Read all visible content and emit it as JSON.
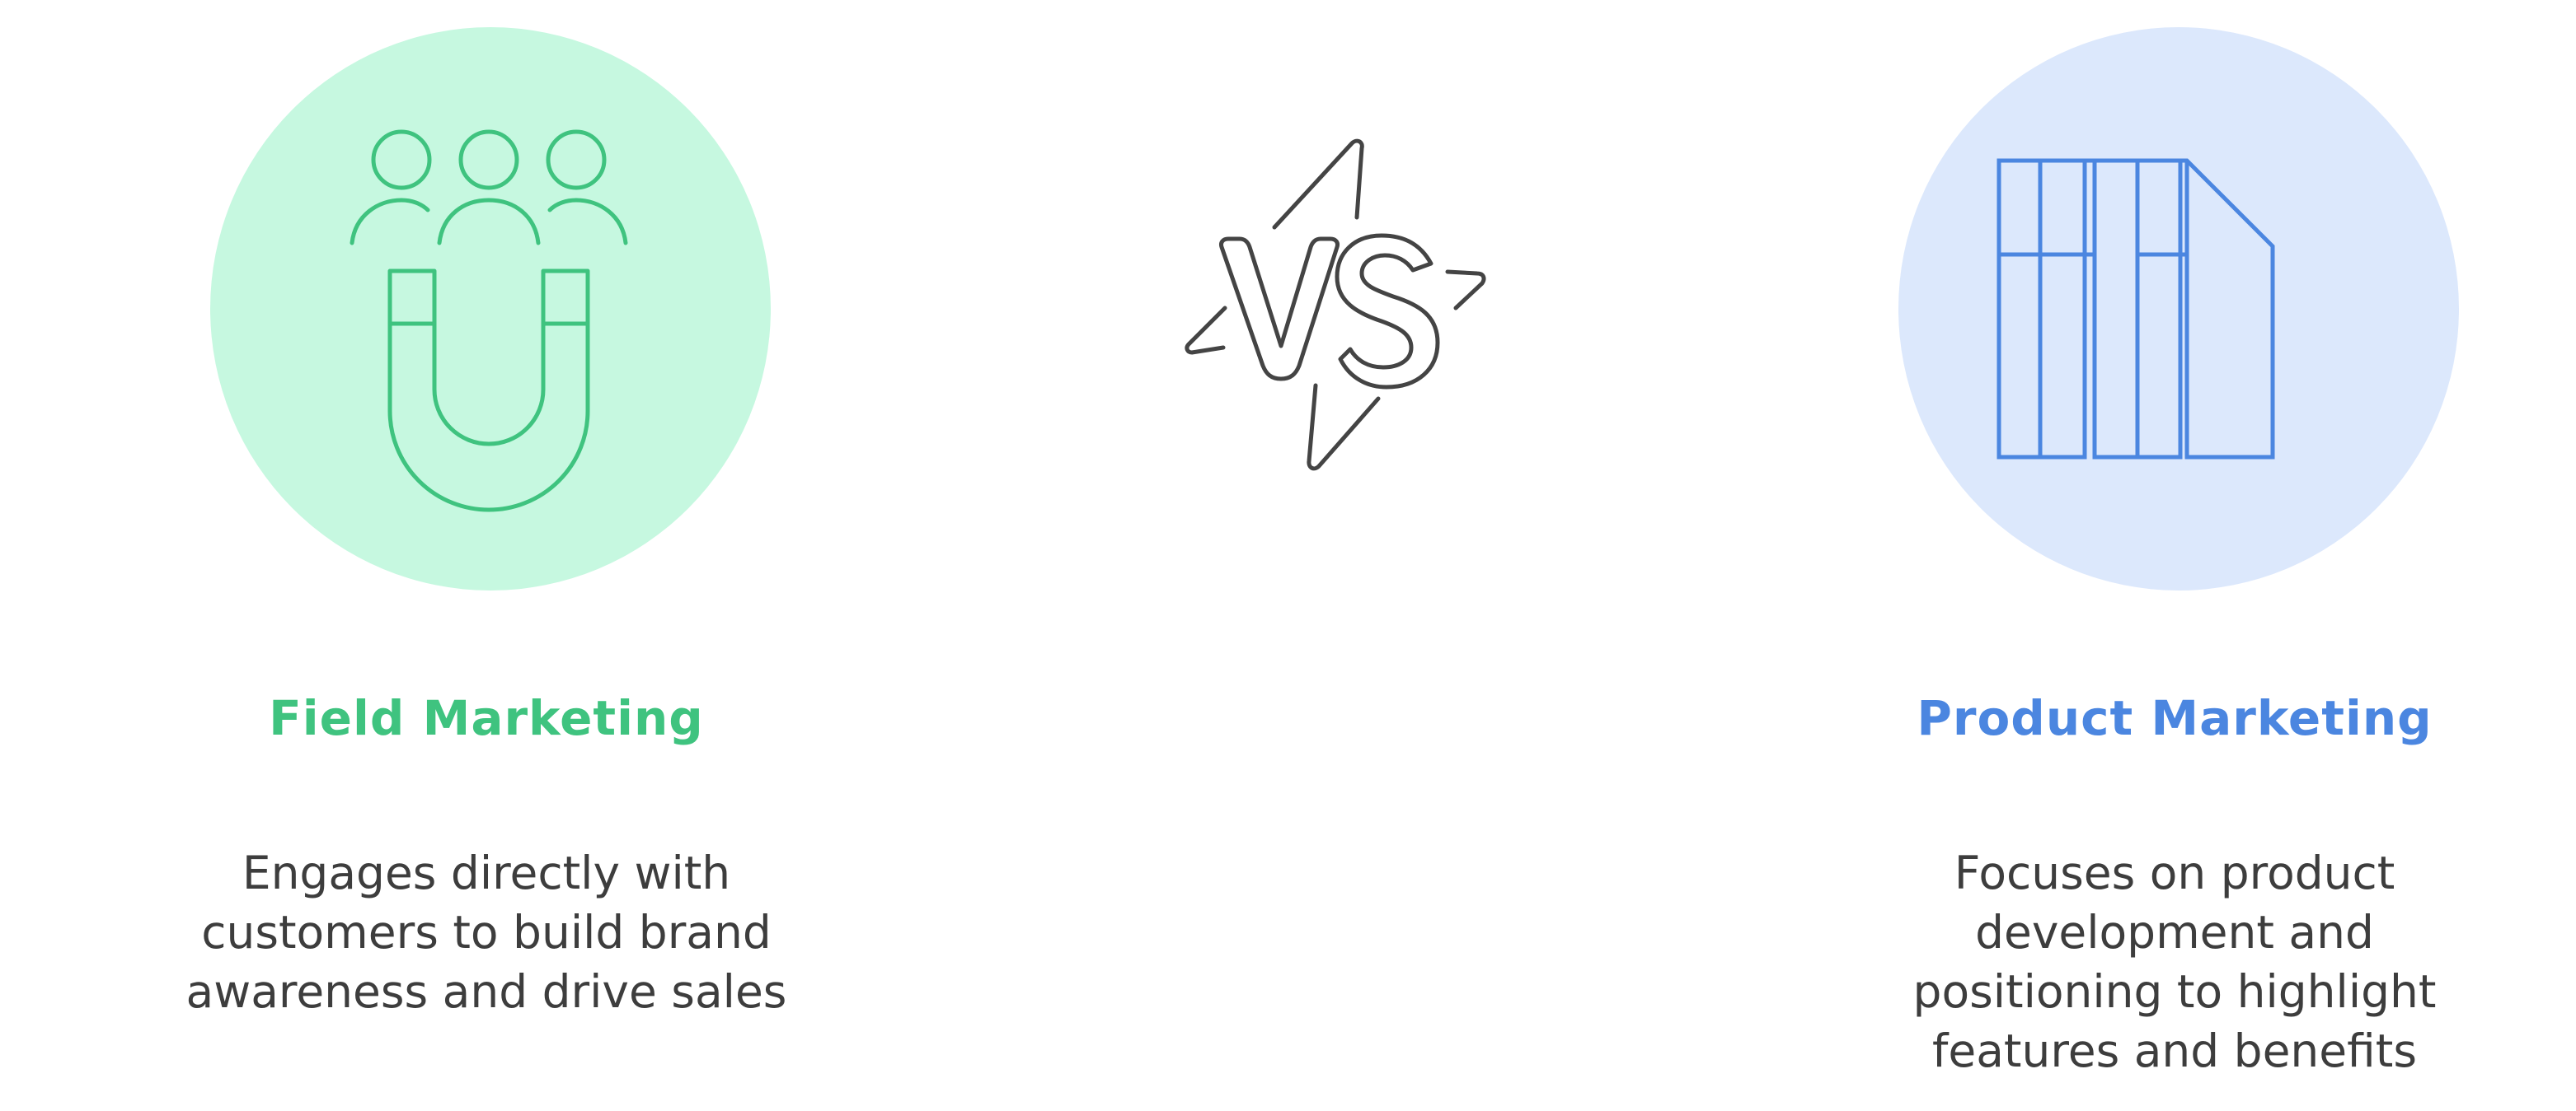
{
  "left": {
    "title": "Field Marketing",
    "description": "Engages directly with customers to build brand awareness and drive sales",
    "icon": "people-magnet-icon",
    "accent_color": "#3fc37f",
    "circle_color": "#c6f8e0"
  },
  "right": {
    "title": "Product Marketing",
    "description": "Focuses on product development and positioning to highlight features and benefits",
    "icon": "book-pages-icon",
    "accent_color": "#4b86e0",
    "circle_color": "#dce8fc"
  },
  "center": {
    "icon": "versus-icon",
    "stroke_color": "#444444"
  }
}
